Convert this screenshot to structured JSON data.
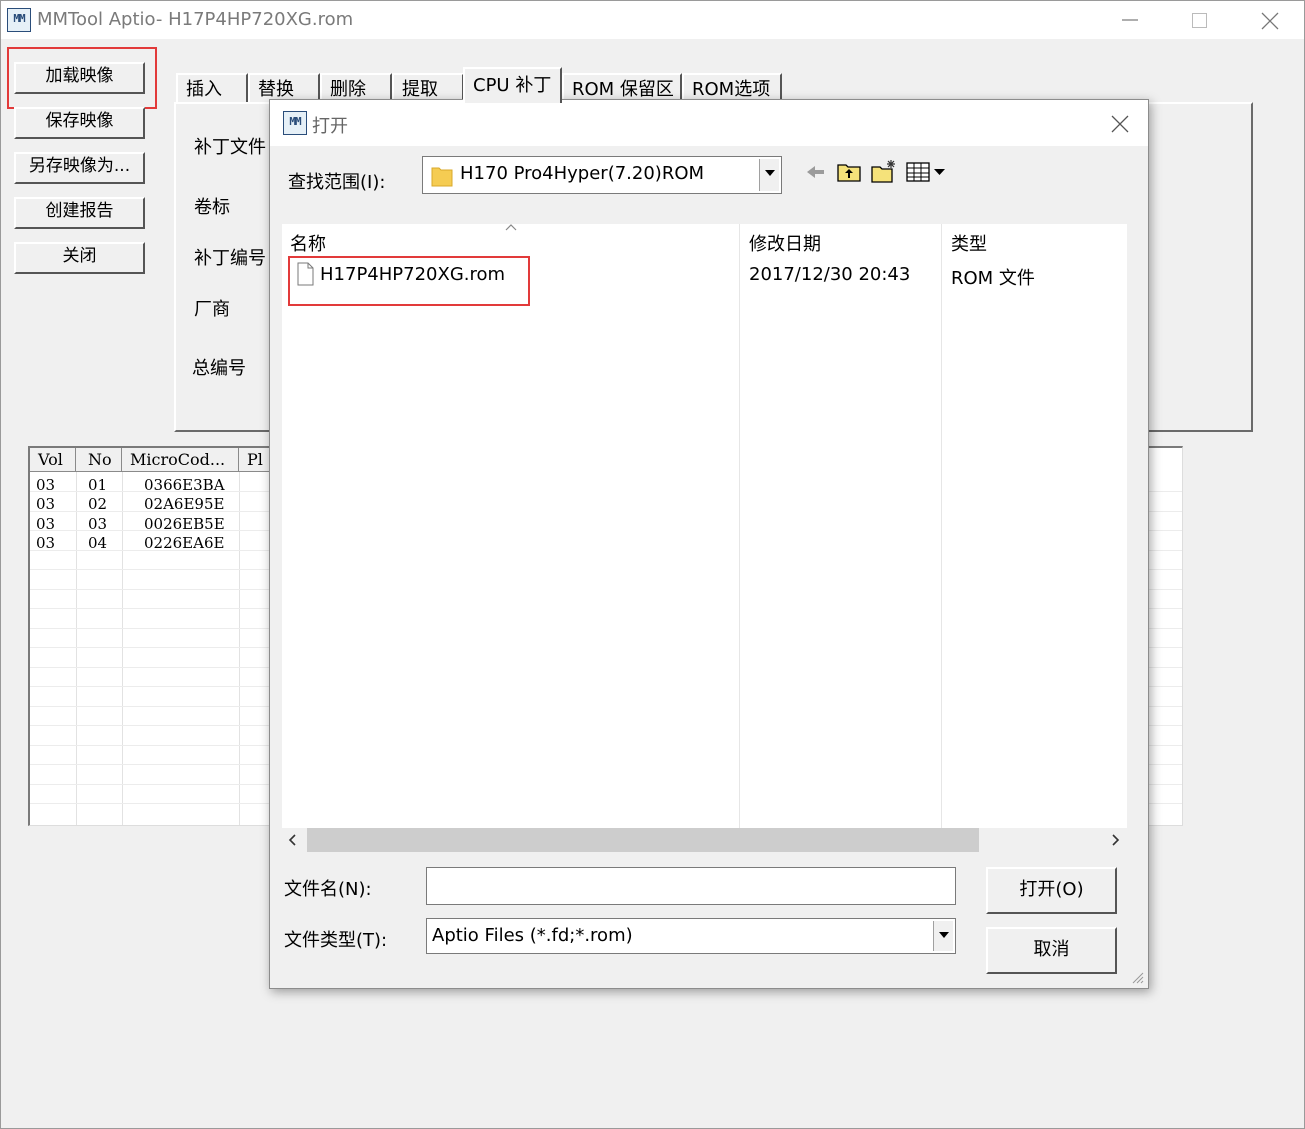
{
  "window": {
    "title": "MMTool Aptio- H17P4HP720XG.rom",
    "logo_text": "MM",
    "controls": [
      "minimize",
      "maximize",
      "close"
    ]
  },
  "left_buttons": {
    "load_image": "加载映像",
    "save_image": "保存映像",
    "save_image_as": "另存映像为...",
    "create_report": "创建报告",
    "close": "关闭"
  },
  "tabs": [
    "插入",
    "替换",
    "删除",
    "提取",
    "CPU 补丁",
    "ROM 保留区",
    "ROM选项"
  ],
  "active_tab_index": 4,
  "panel_labels": {
    "patch_file": "补丁文件",
    "volume": "卷标",
    "patch_number": "补丁编号",
    "vendor": "厂商",
    "total_number": "总编号"
  },
  "grid": {
    "columns": [
      "Vol",
      "No",
      "MicroCod...",
      "Pl"
    ],
    "rows": [
      [
        "03",
        "01",
        "0366E3BA"
      ],
      [
        "03",
        "02",
        "02A6E95E"
      ],
      [
        "03",
        "03",
        "0026EB5E"
      ],
      [
        "03",
        "04",
        "0226EA6E"
      ]
    ]
  },
  "dialog": {
    "title": "打开",
    "look_in_label": "查找范围(I):",
    "look_in_value": "H170 Pro4Hyper(7.20)ROM",
    "columns": {
      "name": "名称",
      "modified": "修改日期",
      "type": "类型"
    },
    "files": [
      {
        "name": "H17P4HP720XG.rom",
        "modified": "2017/12/30 20:43",
        "type": "ROM 文件"
      }
    ],
    "filename_label": "文件名(N):",
    "filename_value": "",
    "filetype_label": "文件类型(T):",
    "filetype_value": "Aptio Files (*.fd;*.rom)",
    "open_button": "打开(O)",
    "cancel_button": "取消"
  },
  "colors": {
    "highlight_box": "#e23a3a",
    "folder_yellow": "#f5cc52"
  }
}
